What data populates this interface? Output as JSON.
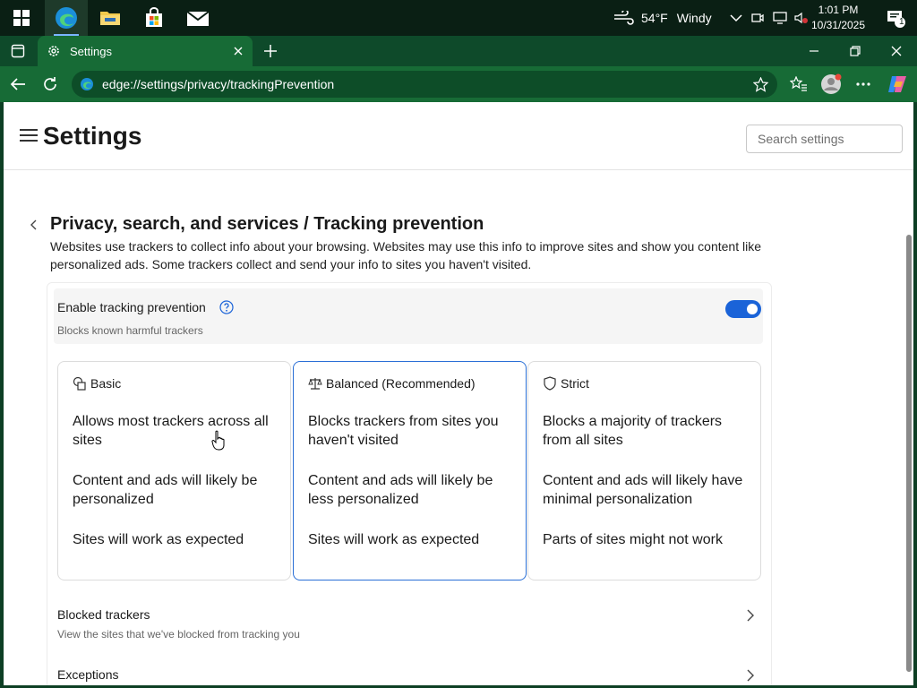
{
  "taskbar": {
    "weather_temp": "54°F",
    "weather_desc": "Windy",
    "time": "1:01 PM",
    "date": "10/31/2025",
    "notification_count": "1"
  },
  "browser": {
    "tab_title": "Settings",
    "url": "edge://settings/privacy/trackingPrevention"
  },
  "settings": {
    "title": "Settings",
    "search_placeholder": "Search settings",
    "breadcrumb": "Privacy, search, and services / Tracking prevention",
    "description": "Websites use trackers to collect info about your browsing. Websites may use this info to improve sites and show you content like personalized ads. Some trackers collect and send your info to sites you haven't visited.",
    "enable": {
      "title": "Enable tracking prevention",
      "subtitle": "Blocks known harmful trackers",
      "enabled": true
    },
    "levels": [
      {
        "name": "Basic",
        "icon": "shapes-icon",
        "selected": false,
        "lines": [
          "Allows most trackers across all sites",
          "Content and ads will likely be personalized",
          "Sites will work as expected"
        ]
      },
      {
        "name": "Balanced (Recommended)",
        "icon": "scale-icon",
        "selected": true,
        "lines": [
          "Blocks trackers from sites you haven't visited",
          "Content and ads will likely be less personalized",
          "Sites will work as expected"
        ]
      },
      {
        "name": "Strict",
        "icon": "shield-icon",
        "selected": false,
        "lines": [
          "Blocks a majority of trackers from all sites",
          "Content and ads will likely have minimal personalization",
          "Parts of sites might not work"
        ]
      }
    ],
    "blocked_trackers": {
      "title": "Blocked trackers",
      "subtitle": "View the sites that we've blocked from tracking you"
    },
    "exceptions": {
      "title": "Exceptions"
    }
  },
  "colors": {
    "accent": "#1a63d8",
    "chrome": "#176b36"
  }
}
